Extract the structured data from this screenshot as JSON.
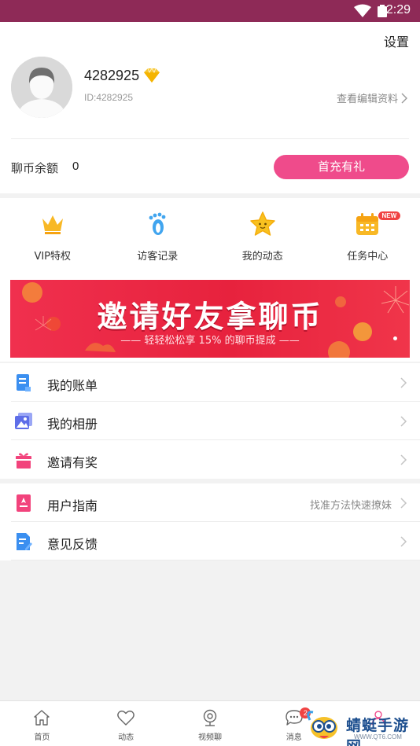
{
  "status_bar": {
    "time": "2:29"
  },
  "profile": {
    "settings_label": "设置",
    "username": "4282925",
    "user_id": "ID:4282925",
    "edit_link": "查看编辑资料",
    "balance_label": "聊币余额",
    "balance_value": "0",
    "recharge_button": "首充有礼"
  },
  "quick_actions": [
    {
      "label": "VIP特权",
      "icon": "crown-icon"
    },
    {
      "label": "访客记录",
      "icon": "footprint-icon"
    },
    {
      "label": "我的动态",
      "icon": "star-icon"
    },
    {
      "label": "任务中心",
      "icon": "calendar-icon",
      "badge": "NEW"
    }
  ],
  "banner": {
    "title": "邀请好友拿聊币",
    "subtitle": "—— 轻轻松松享 15% 的聊币提成 ——"
  },
  "menu_group_1": [
    {
      "label": "我的账单",
      "icon": "bill-icon"
    },
    {
      "label": "我的相册",
      "icon": "album-icon"
    },
    {
      "label": "邀请有奖",
      "icon": "gift-icon"
    }
  ],
  "menu_group_2": [
    {
      "label": "用户指南",
      "icon": "guide-icon",
      "hint": "找准方法快速撩妹"
    },
    {
      "label": "意见反馈",
      "icon": "feedback-icon"
    }
  ],
  "tab_bar": {
    "tabs": [
      {
        "label": "首页",
        "icon": "home-icon"
      },
      {
        "label": "动态",
        "icon": "heart-icon"
      },
      {
        "label": "视频聊",
        "icon": "video-chat-icon"
      },
      {
        "label": "消息",
        "icon": "message-icon",
        "badge": "2"
      },
      {
        "label": "",
        "icon": "me-icon"
      }
    ]
  },
  "watermark": {
    "text": "蜻蜓手游网",
    "url": "WWW.QT6.COM"
  },
  "colors": {
    "status_bar": "#8e2a57",
    "accent_pink": "#ef4b8b",
    "banner_red": "#e7223d"
  }
}
